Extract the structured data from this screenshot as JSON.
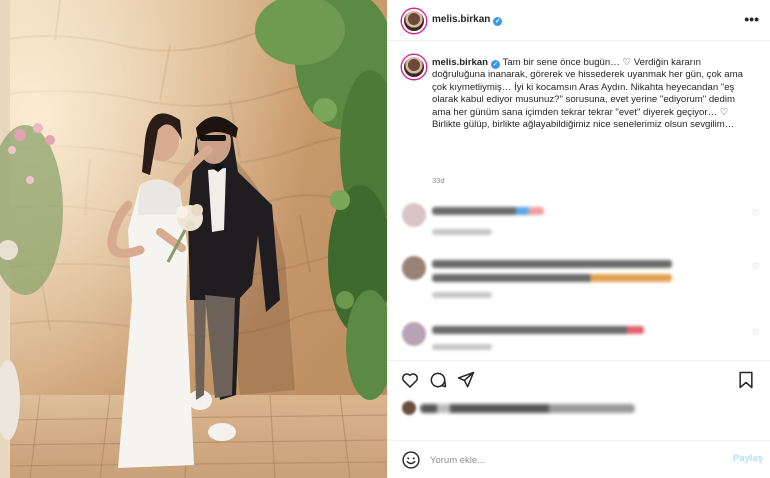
{
  "header": {
    "username": "melis.birkan",
    "more_label": "•••"
  },
  "caption": {
    "username": "melis.birkan",
    "text": "Tam bir sene önce bugün… ♡ Verdiğin kararın doğruluğuna inanarak, görerek ve hissederek uyanmak her gün, çok ama çok kıymetliymiş… İyi ki kocamsın Aras Aydın. Nikahta heyecandan \"eş olarak kabul ediyor musunuz?\" sorusuna, evet yerine \"ediyorum\" dedim ama her günüm sana içimden tekrar tekrar \"evet\" diyerek geçiyor… ♡ Birlikte gülüp, birlikte ağlayabildiğimiz nice senelerimiz olsun sevgilim…",
    "age": "33d"
  },
  "icons": {
    "verified": "verified-badge-icon",
    "heart": "heart-icon",
    "comment": "comment-icon",
    "share": "share-icon",
    "save": "bookmark-icon",
    "emoji": "emoji-icon",
    "more": "more-dots-icon"
  },
  "comments": [
    {
      "id": "c1"
    },
    {
      "id": "c2"
    },
    {
      "id": "c3"
    }
  ],
  "comment_box": {
    "placeholder": "Yorum ekle...",
    "post_label": "Paylaş"
  },
  "colors": {
    "verified": "#3897f0",
    "post_button": "#b2dffc",
    "text": "#262626",
    "secondary_text": "#8e8e8e",
    "divider": "#efefef"
  }
}
